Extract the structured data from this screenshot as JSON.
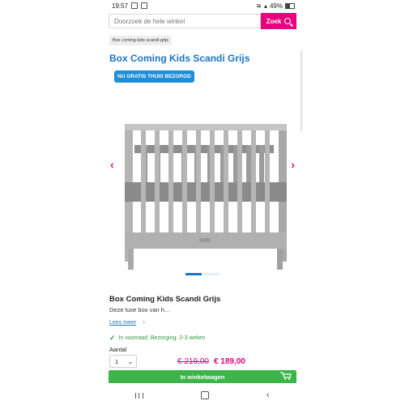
{
  "statusbar": {
    "time": "19:57",
    "battery_text": "49%"
  },
  "search": {
    "placeholder": "Doorzoek de hele winkel",
    "button_label": "Zoek"
  },
  "breadcrumb": "Box coming kids scandi grijs",
  "page_title": "Box Coming Kids Scandi Grijs",
  "gallery": {
    "badge": "NU GRATIS THUIS BEZORGD",
    "prev_icon": "chevron-left-icon",
    "next_icon": "chevron-right-icon",
    "slides": 2,
    "active_slide": 1
  },
  "product": {
    "name": "Box Coming Kids Scandi Grijs",
    "description": "Deze luxe box van h...",
    "read_more": "Lees meer",
    "stock": "In voorraad. Bezorging: 2-3 weken",
    "qty_label": "Aantal",
    "qty_value": "1",
    "price_old": "€ 219,00",
    "price_new": "€ 189,00",
    "cart_button": "In winkelwagen"
  },
  "colors": {
    "brand_pink": "#e6007e",
    "title_blue": "#1b74c4",
    "badge_blue": "#1d8ed7",
    "cart_green": "#3cb44a",
    "crib_grey": "#b4b4b4"
  }
}
